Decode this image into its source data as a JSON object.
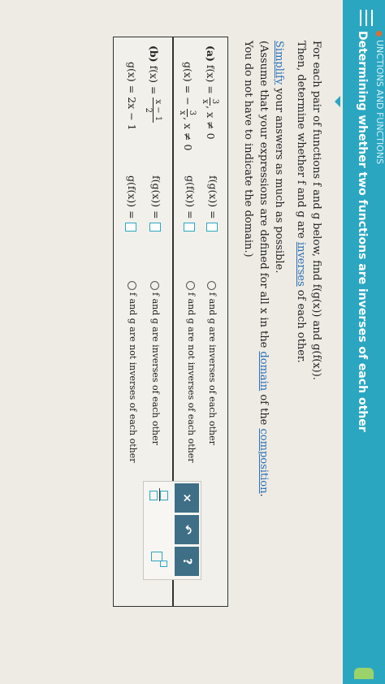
{
  "header": {
    "breadcrumb": "UNCTIONS AND FUNCTIONS",
    "title": "Determining whether two functions are inverses of each other"
  },
  "instructions": {
    "line1": "For each pair of functions f and g below, find f(g(x)) and g(f(x)).",
    "line2_a": "Then, determine whether f and g are ",
    "line2_link": "inverses",
    "line2_b": " of each other.",
    "line3_link": "Simplify",
    "line3_b": " your answers as much as possible.",
    "line4_a": "(Assume that your expressions are defined for all x in the ",
    "line4_link1": "domain",
    "line4_b": " of the ",
    "line4_link2": "composition",
    "line4_c": ".",
    "line5": "You do not have to indicate the domain.)"
  },
  "part_a": {
    "label": "(a)",
    "f_lhs": "f(x) =",
    "f_num": "3",
    "f_den": "x",
    "f_cond": ", x ≠ 0",
    "g_lhs": "g(x) = −",
    "g_num": "3",
    "g_den": "x",
    "g_cond": ", x ≠ 0",
    "fg_label": "f(g(x)) =",
    "gf_label": "g(f(x)) =",
    "option_inverse": "f and g are inverses of each other",
    "option_not_inverse": "f and g are not inverses of each other"
  },
  "part_b": {
    "label": "(b)",
    "f_lhs": "f(x) =",
    "f_num": "x − 1",
    "f_den": "2",
    "g_expr": "g(x) = 2x − 1",
    "fg_label": "f(g(x)) =",
    "gf_label": "g(f(x)) =",
    "option_inverse": "f and g are inverses of each other",
    "option_not_inverse": "f and g are not inverses of each other"
  },
  "toolbox": {
    "clear_symbol": "×",
    "undo_symbol": "↶",
    "help_symbol": "?"
  },
  "colors": {
    "header_bg": "#2ba6c1",
    "tool_bg": "#3e6f86",
    "link": "#2a6fb5"
  }
}
